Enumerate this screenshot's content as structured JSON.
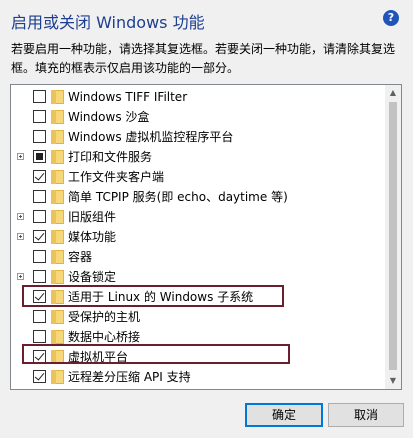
{
  "title": "启用或关闭 Windows 功能",
  "description": "若要启用一种功能，请选择其复选框。若要关闭一种功能，请清除其复选框。填充的框表示仅启用该功能的一部分。",
  "features": [
    {
      "label": "Windows TIFF IFilter",
      "state": "unchecked",
      "expandable": false
    },
    {
      "label": "Windows 沙盒",
      "state": "unchecked",
      "expandable": false
    },
    {
      "label": "Windows 虚拟机监控程序平台",
      "state": "unchecked",
      "expandable": false
    },
    {
      "label": "打印和文件服务",
      "state": "partial",
      "expandable": true
    },
    {
      "label": "工作文件夹客户端",
      "state": "checked",
      "expandable": false
    },
    {
      "label": "简单 TCPIP 服务(即 echo、daytime 等)",
      "state": "unchecked",
      "expandable": false
    },
    {
      "label": "旧版组件",
      "state": "unchecked",
      "expandable": true
    },
    {
      "label": "媒体功能",
      "state": "checked",
      "expandable": true
    },
    {
      "label": "容器",
      "state": "unchecked",
      "expandable": false
    },
    {
      "label": "设备锁定",
      "state": "unchecked",
      "expandable": true
    },
    {
      "label": "适用于 Linux 的 Windows 子系统",
      "state": "checked",
      "expandable": false
    },
    {
      "label": "受保护的主机",
      "state": "unchecked",
      "expandable": false
    },
    {
      "label": "数据中心桥接",
      "state": "unchecked",
      "expandable": false
    },
    {
      "label": "虚拟机平台",
      "state": "checked",
      "expandable": false
    },
    {
      "label": "远程差分压缩 API 支持",
      "state": "checked",
      "expandable": false
    }
  ],
  "buttons": {
    "ok": "确定",
    "cancel": "取消"
  },
  "icons": {
    "help": "?",
    "scroll_up": "▲",
    "scroll_down": "▼"
  },
  "colors": {
    "title": "#1e3f8f",
    "highlight": "#6b1f2e",
    "primary_button_border": "#0078d7"
  }
}
